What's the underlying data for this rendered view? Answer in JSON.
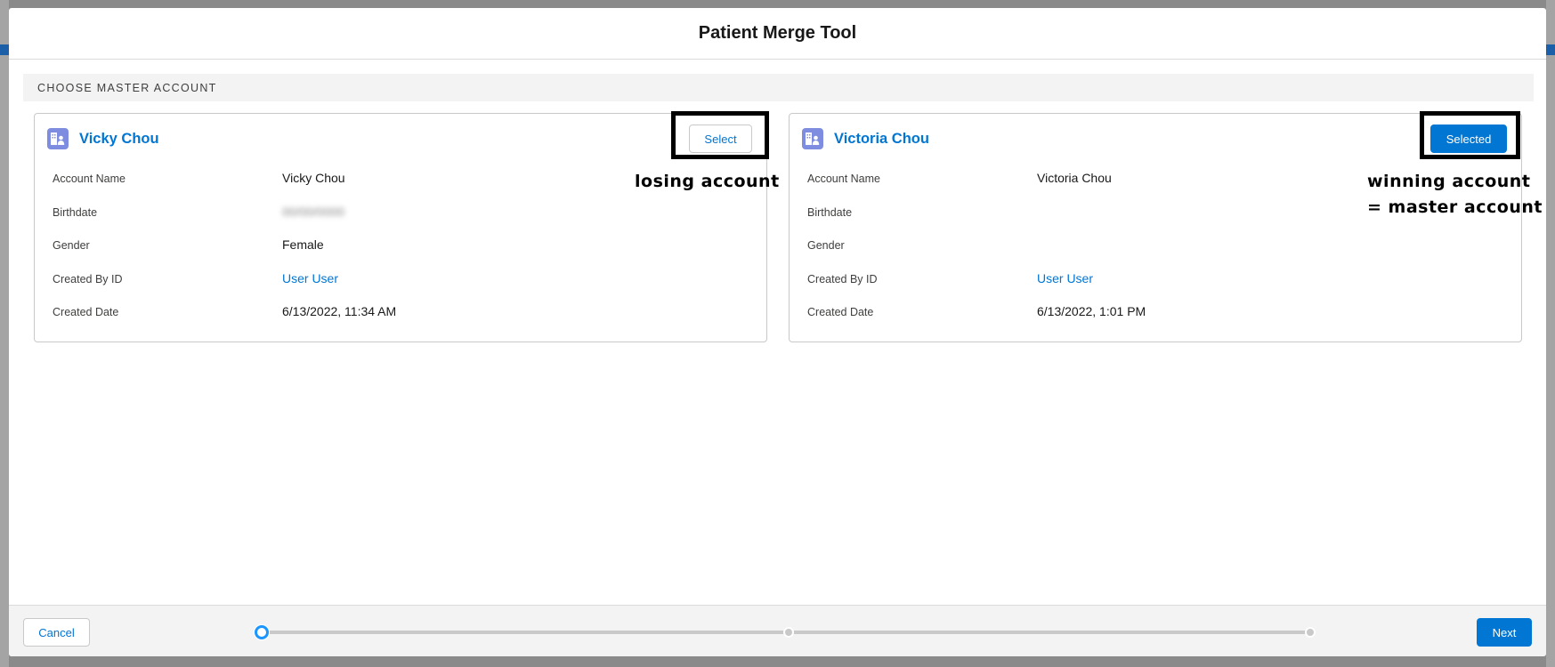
{
  "modal": {
    "title": "Patient Merge Tool"
  },
  "section": {
    "title": "CHOOSE MASTER ACCOUNT"
  },
  "accounts": [
    {
      "name": "Vicky Chou",
      "button_label": "Select",
      "selected": false,
      "fields": [
        {
          "label": "Account Name",
          "value": "Vicky Chou",
          "type": "text"
        },
        {
          "label": "Birthdate",
          "value": "",
          "type": "blurred"
        },
        {
          "label": "Gender",
          "value": "Female",
          "type": "text"
        },
        {
          "label": "Created By ID",
          "value": "User User",
          "type": "link"
        },
        {
          "label": "Created Date",
          "value": "6/13/2022, 11:34 AM",
          "type": "text"
        }
      ]
    },
    {
      "name": "Victoria Chou",
      "button_label": "Selected",
      "selected": true,
      "fields": [
        {
          "label": "Account Name",
          "value": "Victoria Chou",
          "type": "text"
        },
        {
          "label": "Birthdate",
          "value": "",
          "type": "text"
        },
        {
          "label": "Gender",
          "value": "",
          "type": "text"
        },
        {
          "label": "Created By ID",
          "value": "User User",
          "type": "link"
        },
        {
          "label": "Created Date",
          "value": "6/13/2022, 1:01 PM",
          "type": "text"
        }
      ]
    }
  ],
  "annotations": {
    "losing": "losing account",
    "winning_line1": "winning account",
    "winning_line2": "= master account"
  },
  "footer": {
    "cancel_label": "Cancel",
    "next_label": "Next",
    "progress_steps": 3,
    "current_step": 1
  },
  "colors": {
    "brand": "#0176d3",
    "icon_bg": "#7f8de1",
    "progress_active": "#1b96ff"
  },
  "icons": {
    "account": "account-icon"
  }
}
